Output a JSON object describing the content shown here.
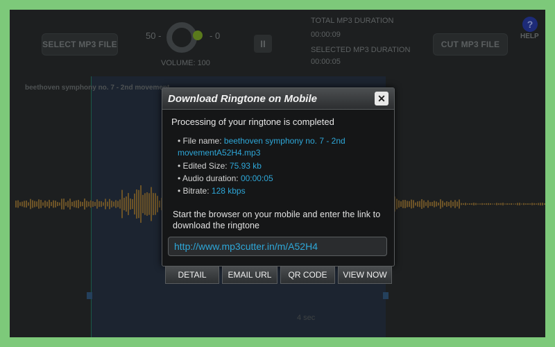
{
  "app": {
    "select_button": "SELECT MP3 FILE",
    "cut_button": "CUT MP3 FILE",
    "volume_min": "50 -",
    "volume_max": "- 0",
    "volume_label": "VOLUME: 100",
    "pause_glyph": "II",
    "total_duration_label": "TOTAL MP3 DURATION",
    "total_duration": "00:00:09",
    "selected_duration_label": "SELECTED MP3 DURATION",
    "selected_duration": "00:00:05",
    "help_glyph": "?",
    "help_label": "HELP",
    "track_title": "beethoven symphony no. 7 - 2nd movement",
    "sec_label": "4 sec"
  },
  "modal": {
    "title": "Download Ringtone on Mobile",
    "close_glyph": "✕",
    "status": "Processing of your ringtone is completed",
    "file_name_label": "• File name: ",
    "file_name_value_1": "beethoven symphony no. 7 - 2nd",
    "file_name_value_2": "movementA52H4.mp3",
    "edited_size_label": "• Edited Size: ",
    "edited_size_value": "75.93 kb",
    "audio_duration_label": "• Audio duration: ",
    "audio_duration_value": "00:00:05",
    "bitrate_label": "• Bitrate: ",
    "bitrate_value": "128 kbps",
    "instruction": "Start the browser on your mobile and enter the link to download the ringtone",
    "url": "http://www.mp3cutter.in/m/A52H4"
  },
  "actions": {
    "detail": "DETAIL",
    "email_url": "EMAIL URL",
    "qr_code": "QR CODE",
    "view_now": "VIEW NOW"
  },
  "colors": {
    "accent": "#2ea7d8",
    "frame": "#7dc97a",
    "waveform": "#6c5327"
  }
}
